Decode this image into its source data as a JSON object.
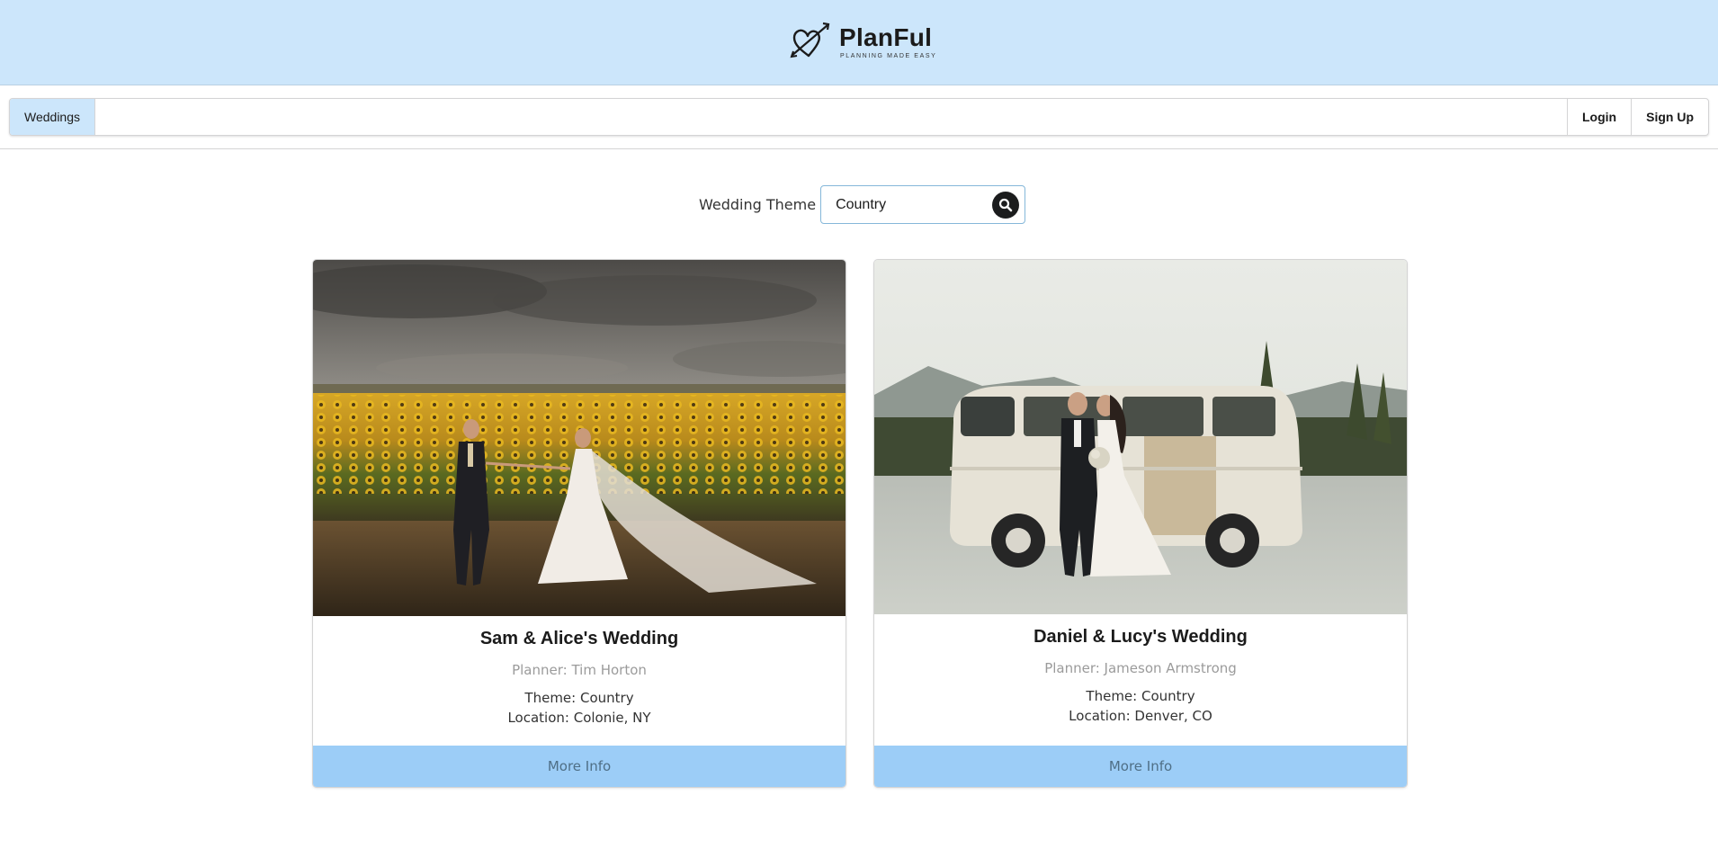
{
  "brand": {
    "name": "PlanFul",
    "tagline": "PLANNING MADE EASY"
  },
  "nav": {
    "items": [
      {
        "label": "Weddings",
        "active": true
      },
      {
        "label": "Login"
      },
      {
        "label": "Sign Up"
      }
    ]
  },
  "search": {
    "label": "Wedding Theme",
    "value": "Country",
    "button_icon": "search-icon"
  },
  "cards": [
    {
      "title": "Sam & Alice's Wedding",
      "planner": "Planner: Tim Horton",
      "theme": "Theme: Country",
      "location": "Location: Colonie, NY",
      "button": "More Info",
      "image": "couple-in-sunflower-field"
    },
    {
      "title": "Daniel & Lucy's Wedding",
      "planner": "Planner: Jameson Armstrong",
      "theme": "Theme: Country",
      "location": "Location: Denver, CO",
      "button": "More Info",
      "image": "couple-kissing-beside-vintage-van"
    }
  ],
  "colors": {
    "header_bg": "#cce6fb",
    "card_button_bg": "#9ccdf7",
    "search_border": "#85b7d9"
  }
}
